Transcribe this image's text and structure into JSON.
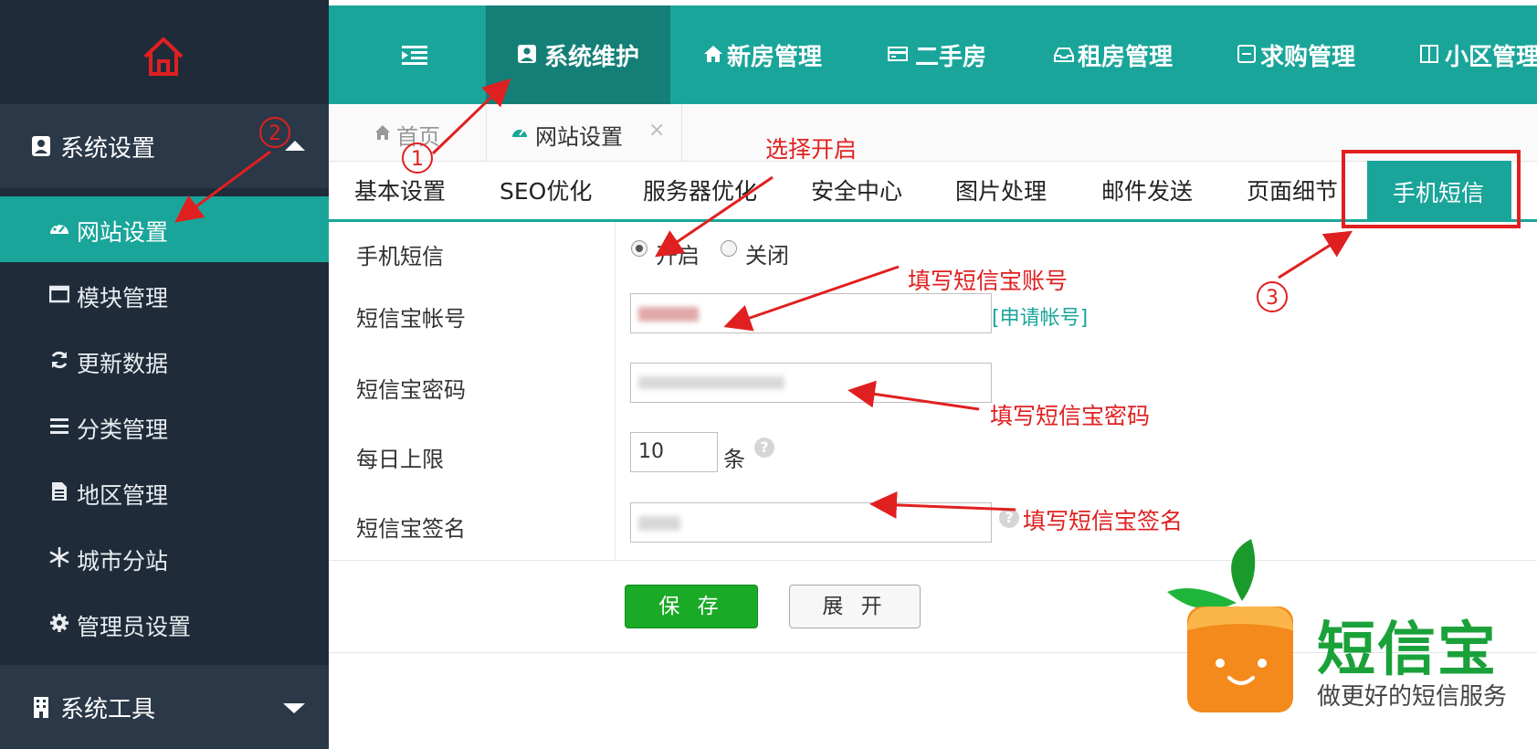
{
  "sidebar": {
    "group_system_settings": "系统设置",
    "items": [
      {
        "label": "网站设置",
        "icon": "dashboard-icon"
      },
      {
        "label": "模块管理",
        "icon": "window-icon"
      },
      {
        "label": "更新数据",
        "icon": "refresh-icon"
      },
      {
        "label": "分类管理",
        "icon": "list-icon"
      },
      {
        "label": "地区管理",
        "icon": "file-icon"
      },
      {
        "label": "城市分站",
        "icon": "snowflake-icon"
      },
      {
        "label": "管理员设置",
        "icon": "gear-icon"
      }
    ],
    "group_system_tools": "系统工具"
  },
  "topnav": {
    "items": [
      {
        "label": "系统维护",
        "icon": "user-card-icon"
      },
      {
        "label": "新房管理",
        "icon": "house-icon"
      },
      {
        "label": "二手房",
        "icon": "card-icon"
      },
      {
        "label": "租房管理",
        "icon": "tray-icon"
      },
      {
        "label": "求购管理",
        "icon": "minus-box-icon"
      },
      {
        "label": "小区管理",
        "icon": "columns-icon"
      }
    ]
  },
  "tabs": {
    "home": "首页",
    "website_settings": "网站设置",
    "close": "×"
  },
  "settings_tabs": [
    "基本设置",
    "SEO优化",
    "服务器优化",
    "安全中心",
    "图片处理",
    "邮件发送",
    "页面细节",
    "手机短信"
  ],
  "form": {
    "sms_label": "手机短信",
    "sms_on": "开启",
    "sms_off": "关闭",
    "account_label": "短信宝帐号",
    "apply_link": "[申请帐号]",
    "password_label": "短信宝密码",
    "daily_limit_label": "每日上限",
    "daily_limit_value": "10",
    "daily_limit_unit": "条",
    "signature_label": "短信宝签名",
    "help": "?"
  },
  "buttons": {
    "save": "保 存",
    "expand": "展 开"
  },
  "annotations": {
    "select_on": "选择开启",
    "fill_account": "填写短信宝账号",
    "fill_password": "填写短信宝密码",
    "fill_signature": "填写短信宝签名",
    "step1": "1",
    "step2": "2",
    "step3": "3"
  },
  "watermark": {
    "title": "短信宝",
    "subtitle": "做更好的短信服务"
  },
  "colors": {
    "teal": "#1aa59a",
    "dark_sidebar": "#1f2b39",
    "red_annotation": "#e02020",
    "green_button": "#1aaa25"
  }
}
